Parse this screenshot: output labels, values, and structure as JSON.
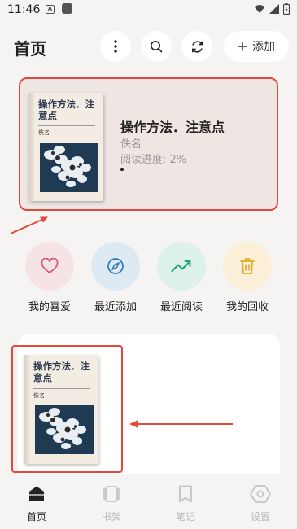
{
  "status": {
    "time": "11:46"
  },
  "header": {
    "title": "首页",
    "add_label": "添加"
  },
  "current_book": {
    "cover_title": "操作方法．注意点",
    "cover_author": "佚名",
    "title": "操作方法．注意点",
    "author": "佚名",
    "progress_text": "阅读进度: 2%",
    "progress": 0.02
  },
  "quick_actions": [
    {
      "label": "我的喜爱",
      "icon": "heart-icon",
      "color": "#f6e3e6",
      "icon_color": "#d9586e"
    },
    {
      "label": "最近添加",
      "icon": "compass-icon",
      "color": "#ddeaf3",
      "icon_color": "#2f7fb8"
    },
    {
      "label": "最近阅读",
      "icon": "trend-up-icon",
      "color": "#dbf1ea",
      "icon_color": "#22a27a"
    },
    {
      "label": "我的回收",
      "icon": "trash-icon",
      "color": "#fbf0d7",
      "icon_color": "#e1a92b"
    }
  ],
  "shelf_book": {
    "cover_title": "操作方法．注意点",
    "cover_author": "佚名"
  },
  "nav": [
    {
      "label": "首页",
      "icon": "home-icon",
      "active": true
    },
    {
      "label": "书架",
      "icon": "bookshelf-icon",
      "active": false
    },
    {
      "label": "笔记",
      "icon": "bookmark-icon",
      "active": false
    },
    {
      "label": "设置",
      "icon": "settings-icon",
      "active": false
    }
  ],
  "colors": {
    "highlight": "#e4483b",
    "accent_dark": "#222222"
  }
}
